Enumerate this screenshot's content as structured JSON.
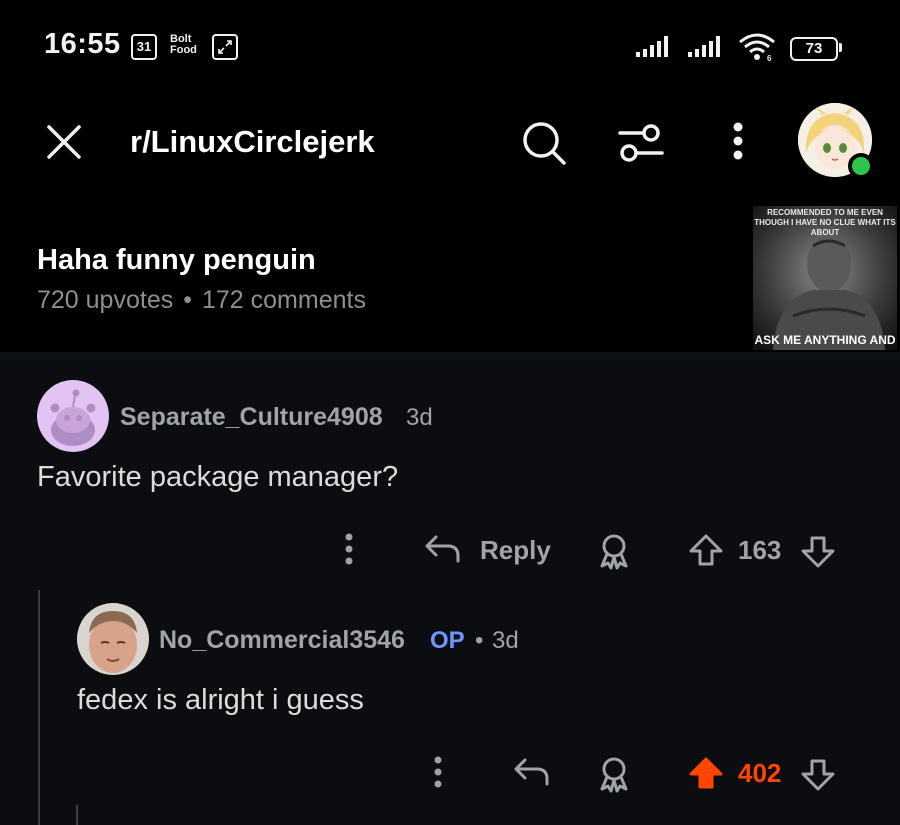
{
  "status_bar": {
    "time": "16:55",
    "calendar_day": "31",
    "bolt_food_line1": "Bolt",
    "bolt_food_line2": "Food",
    "battery": "73"
  },
  "header": {
    "subreddit": "r/LinuxCirclejerk"
  },
  "post": {
    "title": "Haha funny penguin",
    "upvotes": "720 upvotes",
    "separator": "•",
    "comments": "172 comments",
    "thumbnail_top_text": "Recommended to me even though I have no clue what its about",
    "thumbnail_bottom_text": "ASK ME ANYTHING AND"
  },
  "comments": [
    {
      "author": "Separate_Culture4908",
      "time": "3d",
      "body": "Favorite package manager?",
      "reply_label": "Reply",
      "votes": "163"
    },
    {
      "author": "No_Commercial3546",
      "op_badge": "OP",
      "time_sep": "•",
      "time": "3d",
      "body": "fedex is alright i guess",
      "votes": "402"
    }
  ],
  "colors": {
    "background": "#000000",
    "upvote_active": "#ff4500",
    "op_badge": "#6d96ff",
    "online": "#2bc64a"
  }
}
